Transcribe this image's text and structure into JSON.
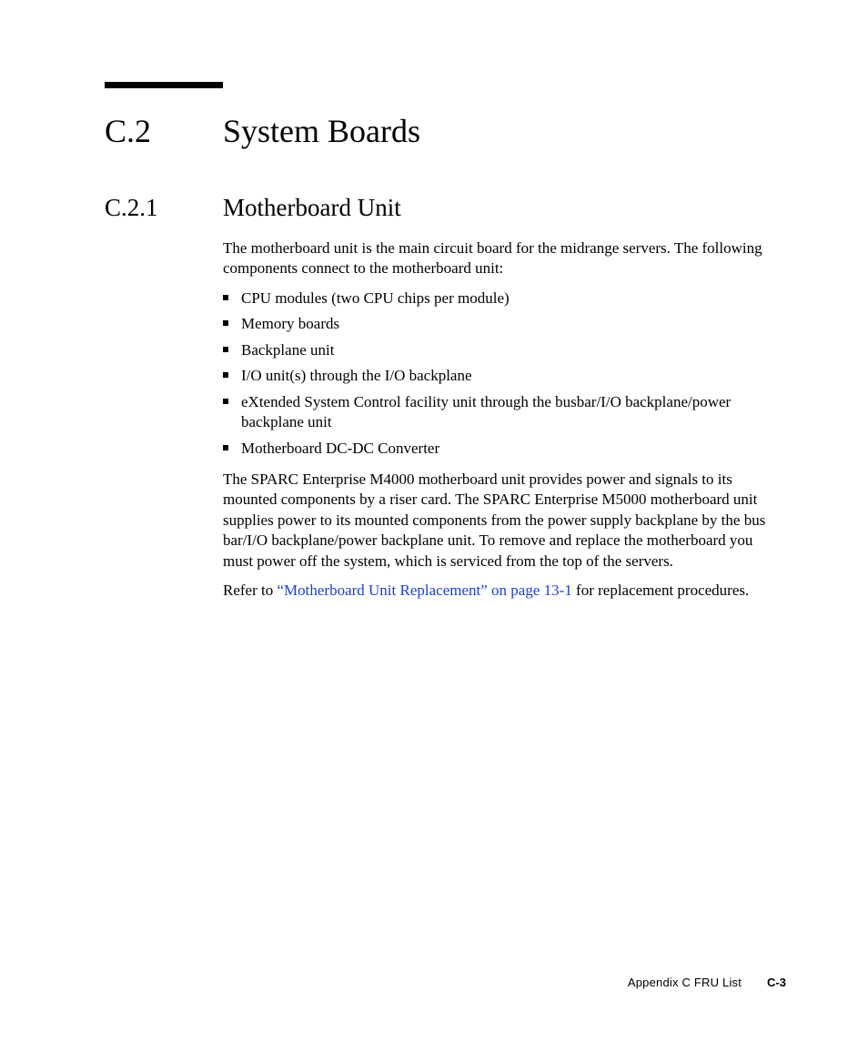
{
  "section": {
    "number": "C.2",
    "title": "System Boards"
  },
  "subsection": {
    "number": "C.2.1",
    "title": "Motherboard Unit",
    "intro": "The motherboard unit is the main circuit board for the midrange servers. The following components connect to the motherboard unit:",
    "bullets": [
      "CPU modules (two CPU chips per module)",
      "Memory boards",
      "Backplane unit",
      "I/O unit(s) through the I/O backplane",
      "eXtended System Control facility unit through the busbar/I/O backplane/power backplane unit",
      "Motherboard DC-DC Converter"
    ],
    "para2": "The SPARC Enterprise M4000 motherboard unit provides power and signals to its mounted components by a riser card. The SPARC Enterprise M5000 motherboard unit supplies power to its mounted components from the power supply backplane by the bus bar/I/O backplane/power backplane unit. To remove and replace the motherboard you must power off the system, which is serviced from the top of the servers.",
    "refer_prefix": "Refer to ",
    "refer_link": "“Motherboard Unit Replacement” on page 13-1",
    "refer_suffix": " for replacement procedures."
  },
  "footer": {
    "appendix": "Appendix C    FRU List",
    "pagenum": "C-3"
  }
}
